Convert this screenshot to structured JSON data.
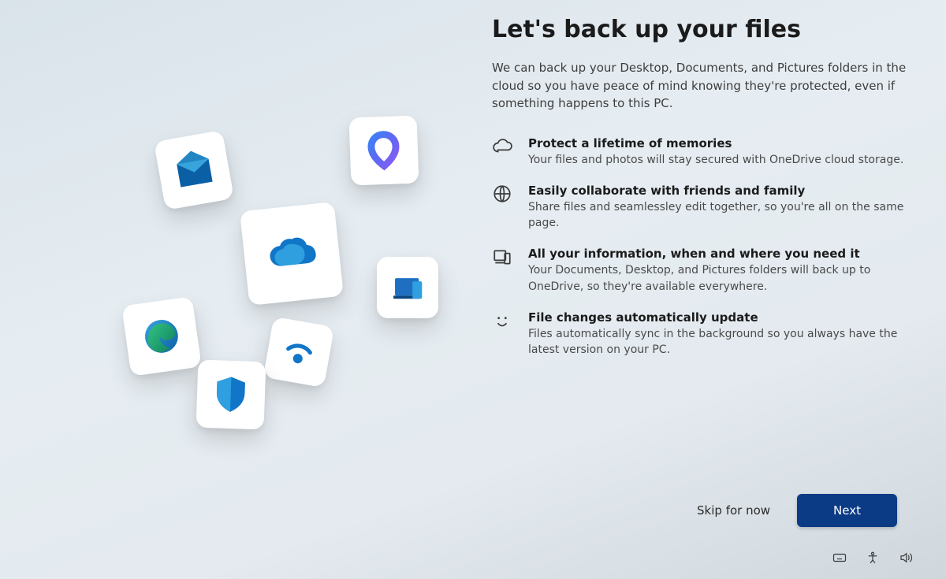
{
  "heading": "Let's back up your files",
  "description": "We can back up your Desktop, Documents, and Pictures folders in the cloud so you have peace of mind knowing they're protected, even if something happens to this PC.",
  "features": [
    {
      "title": "Protect a lifetime of memories",
      "body": "Your files and photos will stay secured with OneDrive cloud storage."
    },
    {
      "title": "Easily collaborate with friends and family",
      "body": "Share files and seamlessley edit together, so you're all on the same page."
    },
    {
      "title": "All your information, when and where you need it",
      "body": "Your Documents, Desktop, and Pictures folders will back up to OneDrive, so they're available everywhere."
    },
    {
      "title": "File changes automatically update",
      "body": "Files automatically sync in the background so you always have the latest version on your PC."
    }
  ],
  "buttons": {
    "skip": "Skip for now",
    "next": "Next"
  },
  "tray": {
    "keyboard": "keyboard-icon",
    "accessibility": "accessibility-icon",
    "volume": "volume-icon"
  },
  "illustration_tiles": {
    "mail": "mail-icon",
    "office": "office-icon",
    "onedrive": "onedrive-icon",
    "devices": "devices-icon",
    "edge": "edge-icon",
    "wifi": "wifi-icon",
    "shield": "shield-icon"
  }
}
